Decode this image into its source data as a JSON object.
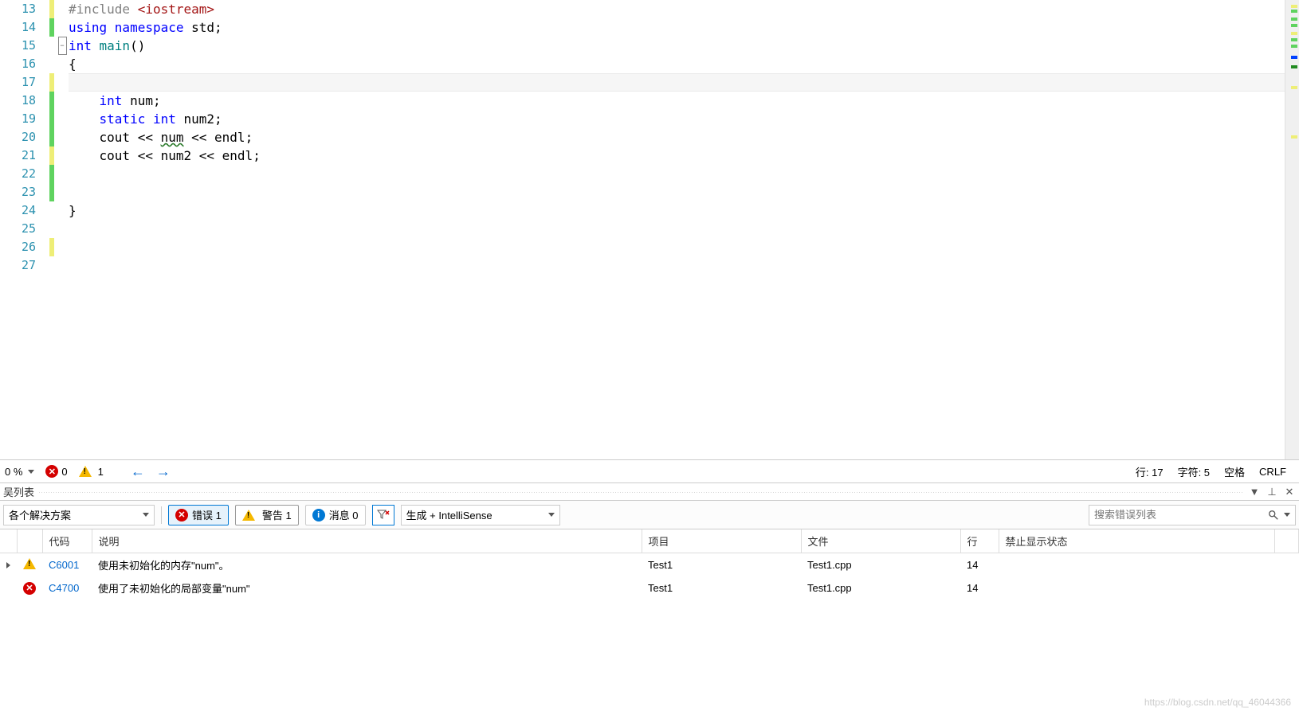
{
  "editor": {
    "lines": [
      {
        "n": 13,
        "change": "yellow",
        "tokens": [
          {
            "t": "#include ",
            "c": "kw-preproc"
          },
          {
            "t": "<iostream>",
            "c": "kw-red"
          }
        ]
      },
      {
        "n": 14,
        "change": "green",
        "tokens": [
          {
            "t": "using ",
            "c": "kw-blue"
          },
          {
            "t": "namespace ",
            "c": "kw-blue"
          },
          {
            "t": "std;",
            "c": "txt"
          }
        ]
      },
      {
        "n": 15,
        "change": "",
        "collapse": true,
        "tokens": [
          {
            "t": "int ",
            "c": "kw-blue"
          },
          {
            "t": "main",
            "c": "kw-teal"
          },
          {
            "t": "()",
            "c": "txt"
          }
        ]
      },
      {
        "n": 16,
        "change": "",
        "tokens": [
          {
            "t": "{",
            "c": "txt"
          }
        ]
      },
      {
        "n": 17,
        "change": "yellow",
        "current": true,
        "tokens": [
          {
            "t": "",
            "c": "txt"
          }
        ]
      },
      {
        "n": 18,
        "change": "green",
        "tokens": [
          {
            "t": "    int ",
            "c": "kw-blue"
          },
          {
            "t": "num;",
            "c": "txt"
          }
        ]
      },
      {
        "n": 19,
        "change": "green",
        "tokens": [
          {
            "t": "    static ",
            "c": "kw-blue"
          },
          {
            "t": "int ",
            "c": "kw-blue"
          },
          {
            "t": "num2;",
            "c": "txt"
          }
        ]
      },
      {
        "n": 20,
        "change": "green",
        "tokens": [
          {
            "t": "    cout << ",
            "c": "txt"
          },
          {
            "t": "num",
            "c": "squiggle"
          },
          {
            "t": " << endl;",
            "c": "txt"
          }
        ]
      },
      {
        "n": 21,
        "change": "yellow",
        "tokens": [
          {
            "t": "    cout << num2 << endl;",
            "c": "txt"
          }
        ]
      },
      {
        "n": 22,
        "change": "green",
        "tokens": [
          {
            "t": "",
            "c": "txt"
          }
        ]
      },
      {
        "n": 23,
        "change": "green",
        "tokens": [
          {
            "t": "",
            "c": "txt"
          }
        ]
      },
      {
        "n": 24,
        "change": "",
        "tokens": [
          {
            "t": "}",
            "c": "txt"
          }
        ]
      },
      {
        "n": 25,
        "change": "",
        "tokens": [
          {
            "t": "",
            "c": "txt"
          }
        ]
      },
      {
        "n": 26,
        "change": "yellow",
        "tokens": [
          {
            "t": "",
            "c": "txt"
          }
        ]
      },
      {
        "n": 27,
        "change": "",
        "tokens": [
          {
            "t": "",
            "c": "txt"
          }
        ]
      }
    ]
  },
  "statusbar": {
    "zoom": "0 %",
    "errors": "0",
    "warnings": "1",
    "line_lbl": "行: 17",
    "col_lbl": "字符: 5",
    "ins_lbl": "空格",
    "eol_lbl": "CRLF"
  },
  "panel": {
    "title": "吴列表"
  },
  "toolbar": {
    "scope": "各个解决方案",
    "errors_lbl": "错误 1",
    "warnings_lbl": "警告 1",
    "messages_lbl": "消息 0",
    "build_lbl": "生成 + IntelliSense",
    "search_placeholder": "搜索错误列表"
  },
  "columns": {
    "code": "代码",
    "desc": "说明",
    "proj": "项目",
    "file": "文件",
    "line": "行",
    "suppress": "禁止显示状态"
  },
  "errors": [
    {
      "expand": true,
      "icon": "warn",
      "code": "C6001",
      "desc": "使用未初始化的内存\"num\"。",
      "proj": "Test1",
      "file": "Test1.cpp",
      "line": "14"
    },
    {
      "expand": false,
      "icon": "err",
      "code": "C4700",
      "desc": "使用了未初始化的局部变量\"num\"",
      "proj": "Test1",
      "file": "Test1.cpp",
      "line": "14"
    }
  ],
  "watermark": "https://blog.csdn.net/qq_46044366"
}
